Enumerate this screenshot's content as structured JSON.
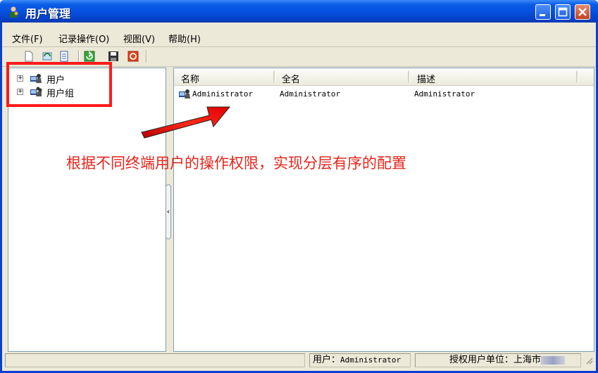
{
  "window": {
    "title": "用户管理"
  },
  "menu": {
    "items": [
      "文件(F)",
      "记录操作(O)",
      "视图(V)",
      "帮助(H)"
    ]
  },
  "toolbar": {
    "icons": [
      "new-icon",
      "refresh-list-icon",
      "properties-icon",
      "refresh-icon",
      "save-icon",
      "stop-icon"
    ]
  },
  "tree": {
    "items": [
      {
        "label": "用户",
        "expander": "+"
      },
      {
        "label": "用户组",
        "expander": "+"
      }
    ]
  },
  "list": {
    "columns": [
      "名称",
      "全名",
      "描述"
    ],
    "rows": [
      {
        "name": "Administrator",
        "full_name": "Administrator",
        "description": "Administrator"
      }
    ]
  },
  "annotation": {
    "text": "根据不同终端用户的操作权限，实现分层有序的配置"
  },
  "status": {
    "user_label": "用户：",
    "user_value": "Administrator",
    "org_label": "授权用户单位：",
    "org_value": "上海市"
  },
  "colors": {
    "title_blue": "#0651e0",
    "annotation_red": "#e5261c",
    "highlight_red": "#ff1a1a"
  }
}
